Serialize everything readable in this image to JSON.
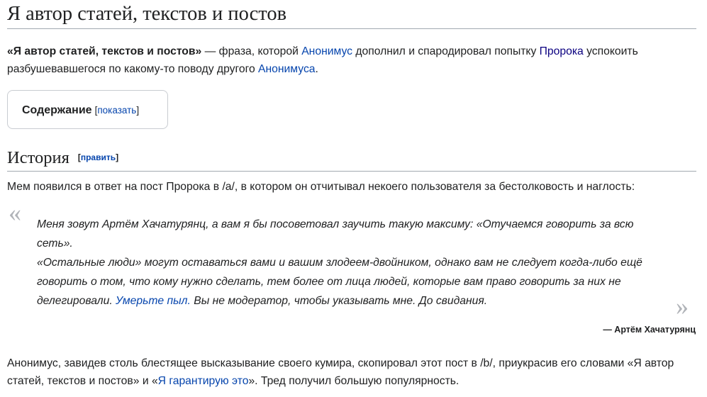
{
  "page": {
    "title": "Я автор статей, текстов и постов"
  },
  "intro": {
    "bold": "«Я автор статей, текстов и постов»",
    "t1": " — фраза, которой ",
    "link1": "Анонимус",
    "t2": " дополнил и спародировал попытку ",
    "link2": "Пророка",
    "t3": " успокоить разбушевавшегося по какому-то поводу другого ",
    "link3": "Анонимуса",
    "t4": "."
  },
  "toc": {
    "title": "Содержание",
    "bracket_open": "[",
    "toggle": "показать",
    "bracket_close": "]"
  },
  "section": {
    "heading": "История",
    "edit_open": "[",
    "edit": "править",
    "edit_close": "]"
  },
  "history": {
    "text": "Мем появился в ответ на пост Пророка в /a/, в котором он отчитывал некоего пользователя за бестолковость и наглость:"
  },
  "quote": {
    "open_mark": "«",
    "close_mark": "»",
    "p1": "Меня зовут Артём Хачатурянц, а вам я бы посоветовал заучить такую максиму: «Отучаемся говорить за всю сеть».",
    "p2_t1": "«Остальные люди» могут оставаться вами и вашим злодеем-двойником, однако вам не следует когда-либо ещё говорить о том, что кому нужно сделать, тем более от лица людей, которые вам право говорить за них не делегировали. ",
    "p2_link": "Умерьте пыл.",
    "p2_t2": " Вы не модератор, чтобы указывать мне. До свидания.",
    "attribution": "— Артём Хачатурянц"
  },
  "after": {
    "t1": "Анонимус, завидев столь блестящее высказывание своего кумира, скопировал этот пост в /b/, приукрасив его словами «Я автор статей, текстов и постов» и «",
    "link": "Я гарантирую это",
    "t2": "». Тред получил большую популярность."
  },
  "colors": {
    "link": "#0645ad",
    "link_visited": "#0b0080",
    "text": "#202122",
    "border": "#a2a9b1"
  }
}
